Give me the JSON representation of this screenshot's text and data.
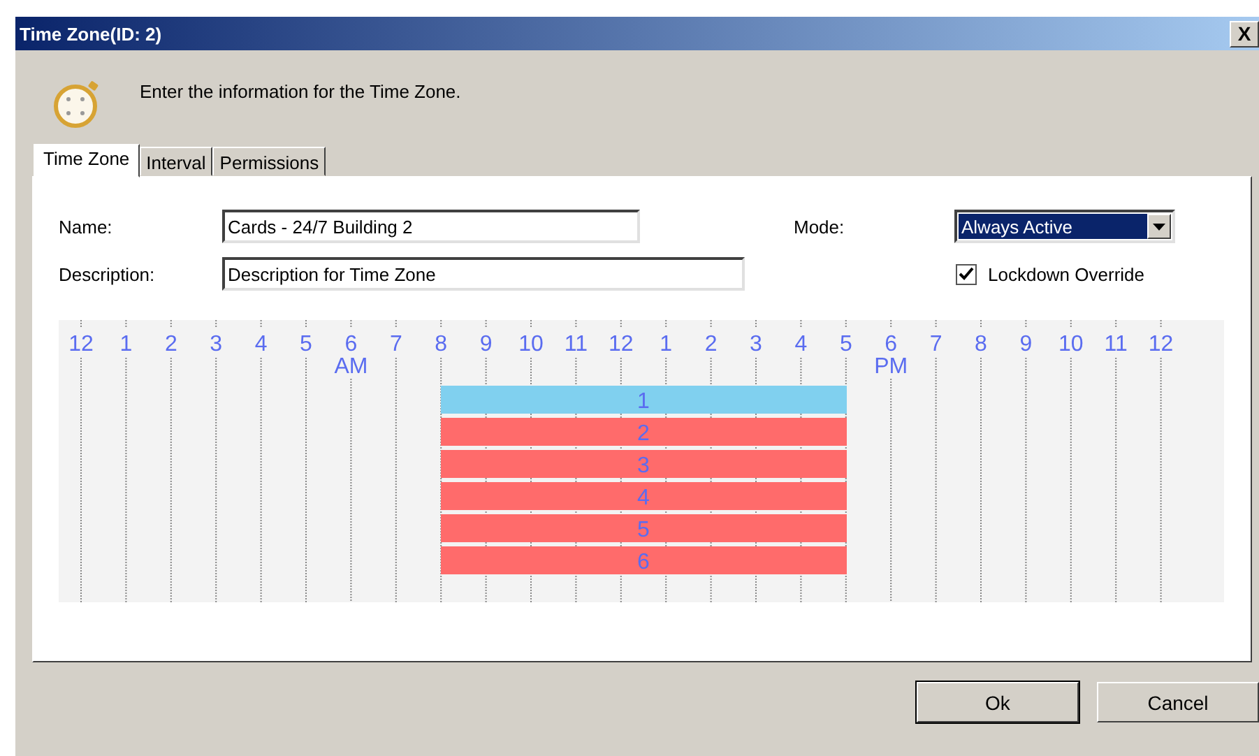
{
  "window": {
    "title": "Time Zone(ID: 2)",
    "close": "X"
  },
  "header": {
    "instruction": "Enter the information for the Time Zone."
  },
  "tabs": [
    {
      "label": "Time Zone",
      "selected": true
    },
    {
      "label": "Interval",
      "selected": false
    },
    {
      "label": "Permissions",
      "selected": false
    }
  ],
  "form": {
    "name_label": "Name:",
    "name_value": "Cards - 24/7 Building 2",
    "description_label": "Description:",
    "description_value": "Description for Time Zone",
    "mode_label": "Mode:",
    "mode_value": "Always Active",
    "lockdown_override": {
      "label": "Lockdown Override",
      "checked": true
    }
  },
  "timeline": {
    "hours": [
      {
        "label": "12",
        "covered": false
      },
      {
        "label": "1",
        "covered": false
      },
      {
        "label": "2",
        "covered": false
      },
      {
        "label": "3",
        "covered": false
      },
      {
        "label": "4",
        "covered": false
      },
      {
        "label": "5",
        "covered": false
      },
      {
        "label": "6",
        "period": "AM",
        "covered": false
      },
      {
        "label": "7",
        "covered": false
      },
      {
        "label": "8",
        "covered": true
      },
      {
        "label": "9",
        "covered": true
      },
      {
        "label": "10",
        "covered": true
      },
      {
        "label": "11",
        "covered": true
      },
      {
        "label": "12",
        "covered": true
      },
      {
        "label": "1",
        "covered": true
      },
      {
        "label": "2",
        "covered": true
      },
      {
        "label": "3",
        "covered": true
      },
      {
        "label": "4",
        "covered": true
      },
      {
        "label": "5",
        "covered": false
      },
      {
        "label": "6",
        "period": "PM",
        "covered": false
      },
      {
        "label": "7",
        "covered": false
      },
      {
        "label": "8",
        "covered": false
      },
      {
        "label": "9",
        "covered": false
      },
      {
        "label": "10",
        "covered": false
      },
      {
        "label": "11",
        "covered": false
      },
      {
        "label": "12",
        "covered": false
      }
    ],
    "intervals": [
      {
        "label": "1",
        "color": "#80d0ef"
      },
      {
        "label": "2",
        "color": "#ff6b6b"
      },
      {
        "label": "3",
        "color": "#ff6b6b"
      },
      {
        "label": "4",
        "color": "#ff6b6b"
      },
      {
        "label": "5",
        "color": "#ff6b6b"
      },
      {
        "label": "6",
        "color": "#ff6b6b"
      }
    ]
  },
  "buttons": [
    "Ok",
    "Cancel"
  ]
}
